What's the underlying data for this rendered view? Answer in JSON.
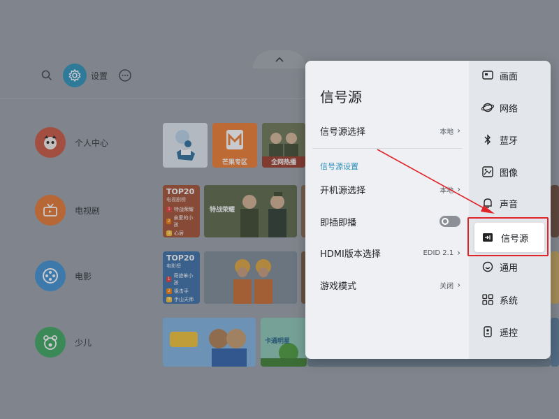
{
  "launcher": {
    "settings_label": "设置",
    "categories": [
      {
        "label": "个人中心",
        "icon": "avatar-icon"
      },
      {
        "label": "电视剧",
        "icon": "tv-icon"
      },
      {
        "label": "电影",
        "icon": "film-reel-icon"
      },
      {
        "label": "少儿",
        "icon": "kids-bear-icon"
      }
    ],
    "tiles": {
      "mango_label": "芒果专区",
      "hot_label": "全网热播",
      "drama_poster_text": "特战荣耀",
      "top20_tv": {
        "title": "TOP20",
        "subtitle": "电视剧榜",
        "items": [
          "特战荣耀",
          "亲爱的小孩",
          "心居"
        ]
      },
      "top20_movie": {
        "title": "TOP20",
        "subtitle": "电影榜",
        "items": [
          "奇迹笨小孩",
          "狙击手",
          "手山天师"
        ]
      },
      "kids_poster_text": "卡通明星"
    }
  },
  "panel": {
    "title": "信号源",
    "source_select": {
      "label": "信号源选择",
      "value": "本地"
    },
    "section_header": "信号源设置",
    "options": [
      {
        "label": "开机源选择",
        "value": "本地",
        "kind": "link"
      },
      {
        "label": "即插即播",
        "value": "",
        "kind": "toggle"
      },
      {
        "label": "HDMI版本选择",
        "value": "EDID 2.1",
        "kind": "link"
      },
      {
        "label": "游戏模式",
        "value": "关闭",
        "kind": "link"
      }
    ]
  },
  "sidebar": {
    "items": [
      {
        "label": "画面",
        "icon": "picture-icon"
      },
      {
        "label": "网络",
        "icon": "network-globe-icon"
      },
      {
        "label": "蓝牙",
        "icon": "bluetooth-icon"
      },
      {
        "label": "图像",
        "icon": "image-icon"
      },
      {
        "label": "声音",
        "icon": "sound-bell-icon"
      },
      {
        "label": "信号源",
        "icon": "input-source-icon",
        "active": true
      },
      {
        "label": "通用",
        "icon": "general-smile-icon"
      },
      {
        "label": "系统",
        "icon": "system-grid-icon"
      },
      {
        "label": "遥控",
        "icon": "remote-icon"
      }
    ]
  },
  "colors": {
    "accent": "#2a8fb7",
    "highlight_annotation": "#e0242a",
    "panel_bg": "#eef0f3",
    "sidebar_bg": "#e3e6ea"
  }
}
